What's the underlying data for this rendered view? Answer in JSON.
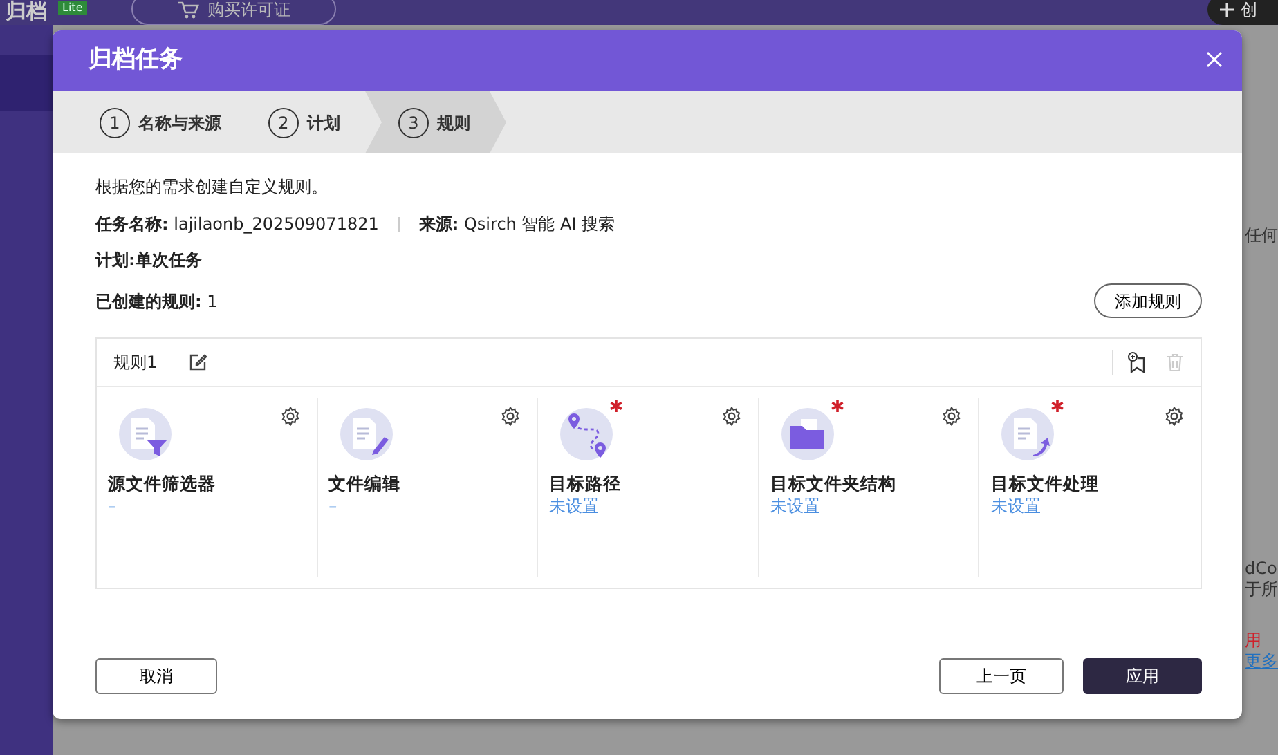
{
  "background": {
    "app_title": "归档",
    "edition_badge": "Lite",
    "buy_button": "购买许可证",
    "create_button": "创",
    "side_texts": [
      {
        "kind": "plain",
        "text": "任何"
      },
      {
        "kind": "plain",
        "text": "dCo"
      },
      {
        "kind": "plain",
        "text": "于所"
      },
      {
        "kind": "alert",
        "text": "用"
      },
      {
        "kind": "link",
        "text": "更多"
      }
    ]
  },
  "dialog": {
    "title": "归档任务",
    "steps": [
      {
        "number": "1",
        "label": "名称与来源",
        "selected": false
      },
      {
        "number": "2",
        "label": "计划",
        "selected": false
      },
      {
        "number": "3",
        "label": "规则",
        "selected": true
      }
    ],
    "intro": "根据您的需求创建自定义规则。",
    "task_name": {
      "label": "任务名称:",
      "value": "lajilaonb_202509071821"
    },
    "source": {
      "label": "来源:",
      "value": "Qsirch 智能 AI 搜索"
    },
    "schedule": "计划:单次任务",
    "rules_created": {
      "label": "已创建的规则:",
      "value": "1"
    },
    "add_rule_button": "添加规则",
    "rule": {
      "name": "规则1",
      "settings": [
        {
          "kind": "filter",
          "title": "源文件筛选器",
          "value": "–",
          "required": false
        },
        {
          "kind": "edit",
          "title": "文件编辑",
          "value": "–",
          "required": false
        },
        {
          "kind": "path",
          "title": "目标路径",
          "value": "未设置",
          "required": true
        },
        {
          "kind": "folder",
          "title": "目标文件夹结构",
          "value": "未设置",
          "required": true
        },
        {
          "kind": "process",
          "title": "目标文件处理",
          "value": "未设置",
          "required": true
        }
      ]
    },
    "buttons": {
      "cancel": "取消",
      "back": "上一页",
      "apply": "应用"
    }
  }
}
